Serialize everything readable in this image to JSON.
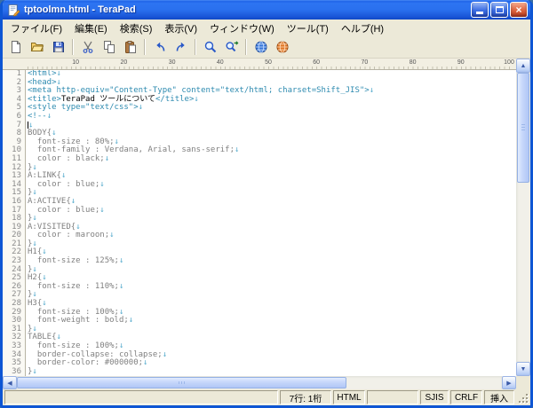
{
  "window": {
    "title": "tptoolmn.html - TeraPad"
  },
  "icons": {
    "close": "×",
    "scroll_up": "▲",
    "scroll_down": "▼",
    "scroll_left": "◀",
    "scroll_right": "▶"
  },
  "menubar": [
    {
      "key": "file",
      "label": "ファイル(F)"
    },
    {
      "key": "edit",
      "label": "編集(E)"
    },
    {
      "key": "search",
      "label": "検索(S)"
    },
    {
      "key": "view",
      "label": "表示(V)"
    },
    {
      "key": "window",
      "label": "ウィンドウ(W)"
    },
    {
      "key": "tool",
      "label": "ツール(T)"
    },
    {
      "key": "help",
      "label": "ヘルプ(H)"
    }
  ],
  "toolbar": [
    {
      "key": "new-file",
      "icon": "new-file-icon"
    },
    {
      "key": "open-file",
      "icon": "open-folder-icon"
    },
    {
      "key": "save-file",
      "icon": "save-floppy-icon"
    },
    {
      "sep": true
    },
    {
      "key": "cut",
      "icon": "scissors-icon"
    },
    {
      "key": "copy",
      "icon": "copy-icon"
    },
    {
      "key": "paste",
      "icon": "paste-icon"
    },
    {
      "sep": true
    },
    {
      "key": "undo",
      "icon": "undo-arrow-icon"
    },
    {
      "key": "redo",
      "icon": "redo-arrow-icon"
    },
    {
      "sep": true
    },
    {
      "key": "find",
      "icon": "magnifier-icon"
    },
    {
      "key": "find-next",
      "icon": "magnifier-next-icon"
    },
    {
      "sep": true
    },
    {
      "key": "browser-preview",
      "icon": "blue-globe-icon"
    },
    {
      "key": "web-site",
      "icon": "orange-globe-icon"
    }
  ],
  "ruler": {
    "ticks": [
      10,
      20,
      30,
      40,
      50,
      60,
      70,
      80,
      90,
      100
    ]
  },
  "editor": {
    "eol_mark": "↓",
    "colors": {
      "tag": "#2e8bb0",
      "comment": "#808080",
      "text": "#000000",
      "eol": "#55aacc",
      "line_number": "#8a8a8a"
    },
    "lines": [
      {
        "n": 1,
        "parts": [
          {
            "c": "tag",
            "t": "<html>"
          }
        ],
        "eol": true
      },
      {
        "n": 2,
        "parts": [
          {
            "c": "tag",
            "t": "<head>"
          }
        ],
        "eol": true
      },
      {
        "n": 3,
        "parts": [
          {
            "c": "tag",
            "t": "<meta http-equiv=\"Content-Type\" content=\"text/html; charset=Shift_JIS\">"
          }
        ],
        "eol": true
      },
      {
        "n": 4,
        "parts": [
          {
            "c": "tag",
            "t": "<title>"
          },
          {
            "c": "text",
            "t": "TeraPad ツールについて"
          },
          {
            "c": "tag",
            "t": "</title>"
          }
        ],
        "eol": true
      },
      {
        "n": 5,
        "parts": [
          {
            "c": "tag",
            "t": "<style type=\"text/css\">"
          }
        ],
        "eol": true
      },
      {
        "n": 6,
        "parts": [
          {
            "c": "tag",
            "t": "<!--"
          }
        ],
        "eol": true
      },
      {
        "n": 7,
        "parts": [],
        "eol": true,
        "caret": true
      },
      {
        "n": 8,
        "parts": [
          {
            "c": "comment",
            "t": "BODY{"
          }
        ],
        "eol": true
      },
      {
        "n": 9,
        "parts": [
          {
            "c": "comment",
            "t": "  font-size : 80%;"
          }
        ],
        "eol": true
      },
      {
        "n": 10,
        "parts": [
          {
            "c": "comment",
            "t": "  font-family : Verdana, Arial, sans-serif;"
          }
        ],
        "eol": true
      },
      {
        "n": 11,
        "parts": [
          {
            "c": "comment",
            "t": "  color : black;"
          }
        ],
        "eol": true
      },
      {
        "n": 12,
        "parts": [
          {
            "c": "comment",
            "t": "}"
          }
        ],
        "eol": true
      },
      {
        "n": 13,
        "parts": [
          {
            "c": "comment",
            "t": "A:LINK{"
          }
        ],
        "eol": true
      },
      {
        "n": 14,
        "parts": [
          {
            "c": "comment",
            "t": "  color : blue;"
          }
        ],
        "eol": true
      },
      {
        "n": 15,
        "parts": [
          {
            "c": "comment",
            "t": "}"
          }
        ],
        "eol": true
      },
      {
        "n": 16,
        "parts": [
          {
            "c": "comment",
            "t": "A:ACTIVE{"
          }
        ],
        "eol": true
      },
      {
        "n": 17,
        "parts": [
          {
            "c": "comment",
            "t": "  color : blue;"
          }
        ],
        "eol": true
      },
      {
        "n": 18,
        "parts": [
          {
            "c": "comment",
            "t": "}"
          }
        ],
        "eol": true
      },
      {
        "n": 19,
        "parts": [
          {
            "c": "comment",
            "t": "A:VISITED{"
          }
        ],
        "eol": true
      },
      {
        "n": 20,
        "parts": [
          {
            "c": "comment",
            "t": "  color : maroon;"
          }
        ],
        "eol": true
      },
      {
        "n": 21,
        "parts": [
          {
            "c": "comment",
            "t": "}"
          }
        ],
        "eol": true
      },
      {
        "n": 22,
        "parts": [
          {
            "c": "comment",
            "t": "H1{"
          }
        ],
        "eol": true
      },
      {
        "n": 23,
        "parts": [
          {
            "c": "comment",
            "t": "  font-size : 125%;"
          }
        ],
        "eol": true
      },
      {
        "n": 24,
        "parts": [
          {
            "c": "comment",
            "t": "}"
          }
        ],
        "eol": true
      },
      {
        "n": 25,
        "parts": [
          {
            "c": "comment",
            "t": "H2{"
          }
        ],
        "eol": true
      },
      {
        "n": 26,
        "parts": [
          {
            "c": "comment",
            "t": "  font-size : 110%;"
          }
        ],
        "eol": true
      },
      {
        "n": 27,
        "parts": [
          {
            "c": "comment",
            "t": "}"
          }
        ],
        "eol": true
      },
      {
        "n": 28,
        "parts": [
          {
            "c": "comment",
            "t": "H3{"
          }
        ],
        "eol": true
      },
      {
        "n": 29,
        "parts": [
          {
            "c": "comment",
            "t": "  font-size : 100%;"
          }
        ],
        "eol": true
      },
      {
        "n": 30,
        "parts": [
          {
            "c": "comment",
            "t": "  font-weight : bold;"
          }
        ],
        "eol": true
      },
      {
        "n": 31,
        "parts": [
          {
            "c": "comment",
            "t": "}"
          }
        ],
        "eol": true
      },
      {
        "n": 32,
        "parts": [
          {
            "c": "comment",
            "t": "TABLE{"
          }
        ],
        "eol": true
      },
      {
        "n": 33,
        "parts": [
          {
            "c": "comment",
            "t": "  font-size : 100%;"
          }
        ],
        "eol": true
      },
      {
        "n": 34,
        "parts": [
          {
            "c": "comment",
            "t": "  border-collapse: collapse;"
          }
        ],
        "eol": true
      },
      {
        "n": 35,
        "parts": [
          {
            "c": "comment",
            "t": "  border-color: #000000;"
          }
        ],
        "eol": true
      },
      {
        "n": 36,
        "parts": [
          {
            "c": "comment",
            "t": "}"
          }
        ],
        "eol": true
      }
    ]
  },
  "statusbar": {
    "message": "",
    "position": "7行: 1桁",
    "doc_type": "HTML",
    "encoding": "SJIS",
    "line_ending": "CRLF",
    "input_mode": "挿入"
  }
}
